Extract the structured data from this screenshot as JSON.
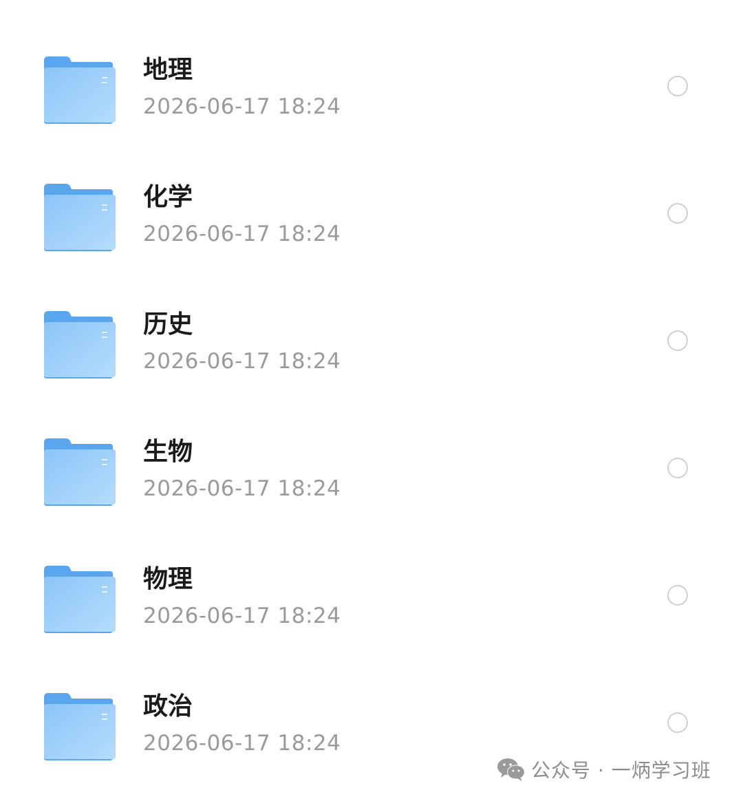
{
  "folders": [
    {
      "name": "地理",
      "date": "2026-06-17 18:24"
    },
    {
      "name": "化学",
      "date": "2026-06-17 18:24"
    },
    {
      "name": "历史",
      "date": "2026-06-17 18:24"
    },
    {
      "name": "生物",
      "date": "2026-06-17 18:24"
    },
    {
      "name": "物理",
      "date": "2026-06-17 18:24"
    },
    {
      "name": "政治",
      "date": "2026-06-17 18:24"
    }
  ],
  "icons": {
    "folder": "folder-icon",
    "select": "radio-circle-icon",
    "watermark": "wechat-icon"
  },
  "colors": {
    "folder_light": "#a6d3fb",
    "folder_dark": "#5aa6ee",
    "radio_border": "#cfcfcf",
    "title": "#1a1a1a",
    "date": "#9a9a9a"
  },
  "watermark": {
    "text": "公众号 · 一炳学习班"
  }
}
